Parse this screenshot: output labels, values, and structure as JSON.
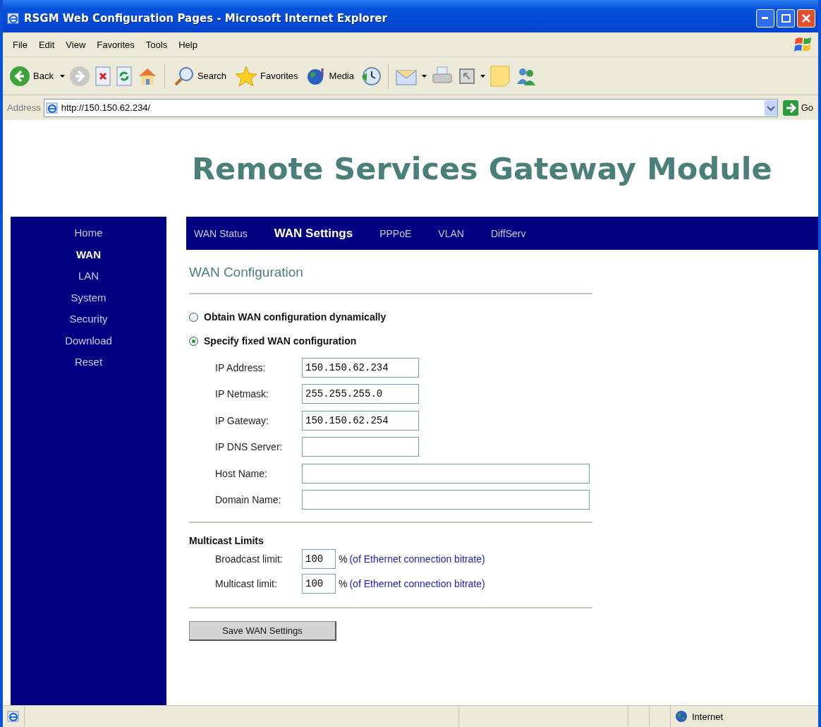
{
  "window": {
    "title": "RSGM Web Configuration Pages - Microsoft Internet Explorer"
  },
  "menu": [
    "File",
    "Edit",
    "View",
    "Favorites",
    "Tools",
    "Help"
  ],
  "toolbar": {
    "back": "Back",
    "search": "Search",
    "favorites": "Favorites",
    "media": "Media"
  },
  "address": {
    "label": "Address",
    "value": "http://150.150.62.234/",
    "go": "Go"
  },
  "page": {
    "banner": "Remote Services Gateway Module",
    "sidebar": [
      {
        "label": "Home",
        "selected": false
      },
      {
        "label": "WAN",
        "selected": true
      },
      {
        "label": "LAN",
        "selected": false
      },
      {
        "label": "System",
        "selected": false
      },
      {
        "label": "Security",
        "selected": false
      },
      {
        "label": "Download",
        "selected": false
      },
      {
        "label": "Reset",
        "selected": false
      }
    ],
    "tabs": [
      {
        "label": "WAN Status",
        "selected": false
      },
      {
        "label": "WAN Settings",
        "selected": true
      },
      {
        "label": "PPPoE",
        "selected": false
      },
      {
        "label": "VLAN",
        "selected": false
      },
      {
        "label": "DiffServ",
        "selected": false
      }
    ],
    "section_title": "WAN Configuration",
    "modes": [
      {
        "label": "Obtain WAN configuration dynamically",
        "selected": false
      },
      {
        "label": "Specify fixed WAN configuration",
        "selected": true
      }
    ],
    "fields": [
      {
        "label": "IP Address:",
        "value": "150.150.62.234",
        "kind": "short"
      },
      {
        "label": "IP Netmask:",
        "value": "255.255.255.0",
        "kind": "short"
      },
      {
        "label": "IP Gateway:",
        "value": "150.150.62.254",
        "kind": "short"
      },
      {
        "label": "IP DNS Server:",
        "kind": "short"
      },
      {
        "label": "Host Name:",
        "kind": "long"
      },
      {
        "label": "Domain Name:",
        "kind": "long"
      }
    ],
    "multicast": {
      "title": "Multicast Limits",
      "limits": [
        {
          "label": "Broadcast limit:",
          "value": "100",
          "unit": "%",
          "note": "(of Ethernet connection bitrate)"
        },
        {
          "label": "Multicast limit:",
          "value": "100",
          "unit": "%",
          "note": "(of Ethernet connection bitrate)"
        }
      ]
    },
    "save_button": "Save WAN Settings"
  },
  "status_bar": {
    "zone": "Internet"
  }
}
